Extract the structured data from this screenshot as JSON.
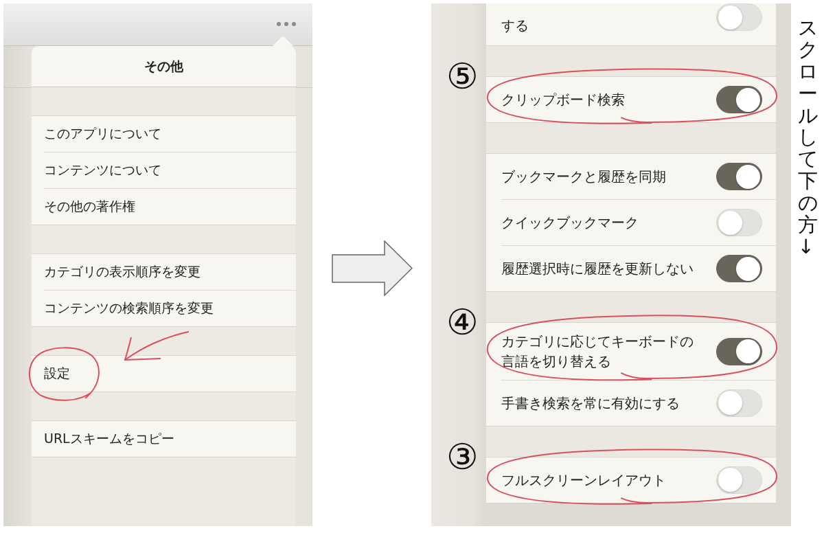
{
  "left_screen": {
    "popover": {
      "title": "その他",
      "groups": [
        {
          "items": [
            {
              "label": "このアプリについて",
              "circled": false,
              "arrow": false
            },
            {
              "label": "コンテンツについて",
              "circled": false,
              "arrow": false
            },
            {
              "label": "その他の著作権",
              "circled": false,
              "arrow": false
            }
          ]
        },
        {
          "items": [
            {
              "label": "カテゴリの表示順序を変更",
              "circled": false,
              "arrow": false
            },
            {
              "label": "コンテンツの検索順序を変更",
              "circled": false,
              "arrow": false
            }
          ]
        },
        {
          "items": [
            {
              "label": "設定",
              "circled": true,
              "arrow": true
            }
          ]
        },
        {
          "items": [
            {
              "label": "URLスキームをコピー",
              "circled": false,
              "arrow": false
            }
          ]
        }
      ]
    }
  },
  "right_screen": {
    "groups": [
      {
        "items": [
          {
            "label": "する",
            "on": false,
            "circled": false
          }
        ]
      },
      {
        "items": [
          {
            "label": "クリップボード検索",
            "on": true,
            "circled": true,
            "marker": "⑤"
          }
        ]
      },
      {
        "items": [
          {
            "label": "ブックマークと履歴を同期",
            "on": true,
            "circled": false
          },
          {
            "label": "クイックブックマーク",
            "on": false,
            "circled": false
          },
          {
            "label": "履歴選択時に履歴を更新しない",
            "on": true,
            "circled": false
          }
        ]
      },
      {
        "items": [
          {
            "label": "カテゴリに応じてキーボードの言語を切り替える",
            "on": true,
            "circled": true,
            "marker": "④"
          },
          {
            "label": "手書き検索を常に有効にする",
            "on": false,
            "circled": false
          }
        ]
      },
      {
        "items": [
          {
            "label": "フルスクリーンレイアウト",
            "on": false,
            "circled": true,
            "marker": "③"
          }
        ]
      }
    ]
  },
  "side_note": "スクロールして下の方↓"
}
